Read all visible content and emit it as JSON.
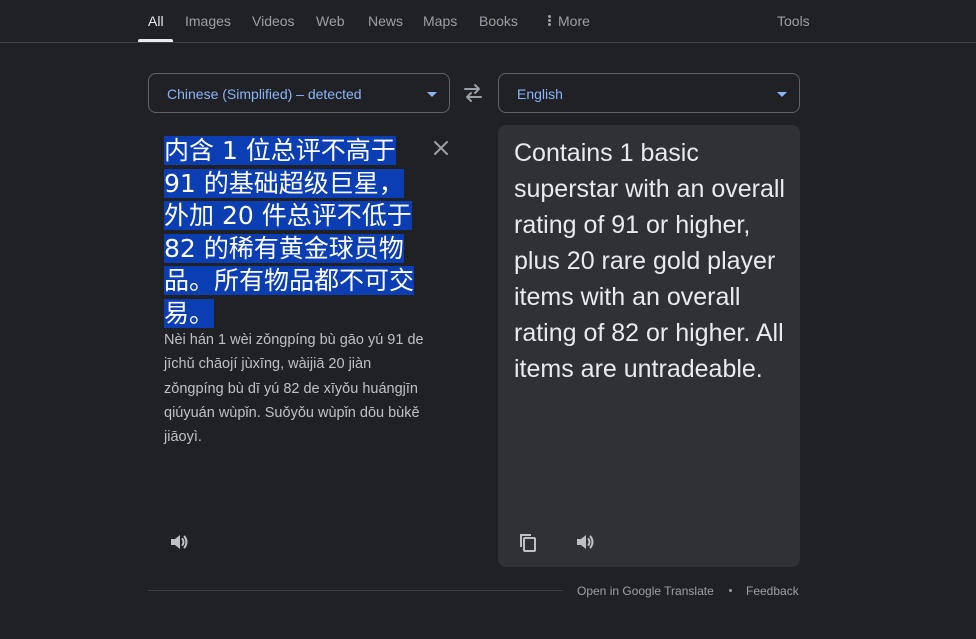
{
  "nav": {
    "tabs": [
      {
        "label": "All",
        "active": true
      },
      {
        "label": "Images"
      },
      {
        "label": "Videos"
      },
      {
        "label": "Web"
      },
      {
        "label": "News"
      },
      {
        "label": "Maps"
      },
      {
        "label": "Books"
      },
      {
        "label": "More"
      }
    ],
    "tools": "Tools"
  },
  "translate": {
    "source_lang": "Chinese (Simplified) – detected",
    "target_lang": "English",
    "source_text": "内含 1 位总评不高于 91 的基础超级巨星，外加 20 件总评不低于 82 的稀有黄金球员物品。所有物品都不可交易。",
    "romanization": "Nèi hán 1 wèi zǒngpíng bù gāo yú 91 de jīchǔ chāojí jùxīng, wàijiā 20 jiàn zǒngpíng bù dī yú 82 de xīyǒu huángjīn qiúyuán wùpǐn. Suǒyǒu wùpǐn dōu bùkě jiāoyì.",
    "translated_text": "Contains 1 basic superstar with an overall rating of 91 or higher, plus 20 rare gold player items with an overall rating of 82 or higher. All items are untradeable."
  },
  "footer": {
    "open_link": "Open in Google Translate",
    "feedback": "Feedback"
  },
  "icons": {
    "swap": "swap-arrows-icon",
    "clear": "close-icon",
    "source_speaker": "speaker-icon",
    "copy": "copy-icon",
    "target_speaker": "speaker-icon",
    "more": "vertical-dots-icon"
  },
  "colors": {
    "background": "#202124",
    "panel": "#303134",
    "accent_link": "#8ab4f8",
    "selection": "#0b3eb3"
  }
}
